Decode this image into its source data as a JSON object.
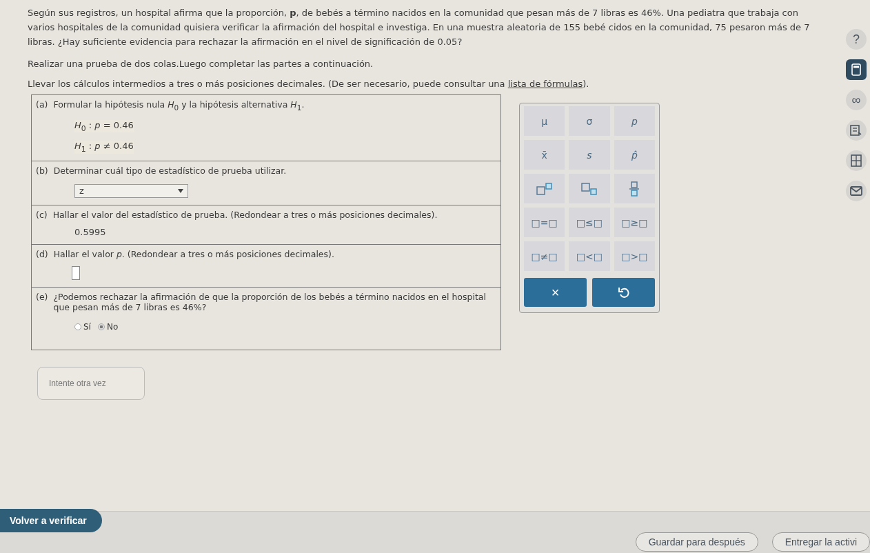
{
  "intro": "Según sus registros, un hospital afirma que la proporción, **p**, de bebés a término nacidos en la comunidad que pesan más de 7 libras es 46%. Una pediatra que trabaja con varios hospitales de la comunidad quisiera verificar la afirmación del hospital e investiga. En una muestra aleatoria de 155 bebé cidos en la comunidad, 75 pesaron más de 7 libras. ¿Hay suficiente evidencia para rechazar la afirmación en el nivel de significación de 0.05?",
  "instruction": "Realizar una prueba de dos colas.Luego completar las partes a continuación.",
  "note": "Llevar los cálculos intermedios a tres o más posiciones decimales. (De ser necesario, puede consultar una",
  "note_link": "lista de fórmulas",
  "note_end": ").",
  "parts": [
    {
      "kind": "hypotheses",
      "letter": "(a)",
      "prompt": "Formular la hipótesis nula *H*$_{0}$ y la hipótesis alternativa *H*$_{1}$.",
      "lines": [
        "*H*$_{0}$ : *p* = 0.46",
        "*H*$_{1}$ : *p* ≠ 0.46"
      ]
    },
    {
      "kind": "dropdown",
      "letter": "(b)",
      "prompt": "Determinar cuál tipo de estadístico de prueba utilizar.",
      "value": "z"
    },
    {
      "kind": "value",
      "letter": "(c)",
      "prompt": "Hallar el valor del estadístico de prueba. (Redondear a tres o más posiciones decimales).",
      "value": "0.5995"
    },
    {
      "kind": "input",
      "letter": "(d)",
      "prompt": "Hallar el valor *p*. (Redondear a tres o más posiciones decimales)."
    },
    {
      "kind": "radio",
      "letter": "(e)",
      "prompt": "¿Podemos rechazar la afirmación de que la proporción de los bebés a término nacidos en el hospital que pesan más de 7 libras es 46%?",
      "options": [
        {
          "label": "Sí",
          "selected": false
        },
        {
          "label": "No",
          "selected": true
        }
      ]
    }
  ],
  "keypad": [
    {
      "kind": "text",
      "label": "μ"
    },
    {
      "kind": "text",
      "label": "σ"
    },
    {
      "kind": "italic",
      "label": "p"
    },
    {
      "kind": "text",
      "label": "x̄"
    },
    {
      "kind": "italic",
      "label": "s"
    },
    {
      "kind": "italic",
      "label": "p̂"
    },
    {
      "kind": "superscript"
    },
    {
      "kind": "subscript"
    },
    {
      "kind": "fraction"
    },
    {
      "kind": "text",
      "label": "□=□"
    },
    {
      "kind": "text",
      "label": "□≤□"
    },
    {
      "kind": "text",
      "label": "□≥□"
    },
    {
      "kind": "text",
      "label": "□≠□"
    },
    {
      "kind": "text",
      "label": "□<□"
    },
    {
      "kind": "text",
      "label": "□>□"
    }
  ],
  "keypad_actions": [
    "×"
  ],
  "sidebar_help": "?",
  "sidebar_infinity": "∞",
  "feedback": "Intente otra vez",
  "footer": {
    "recheck": "Volver a verificar",
    "save": "Guardar para después",
    "submit": "Entregar la activi"
  }
}
